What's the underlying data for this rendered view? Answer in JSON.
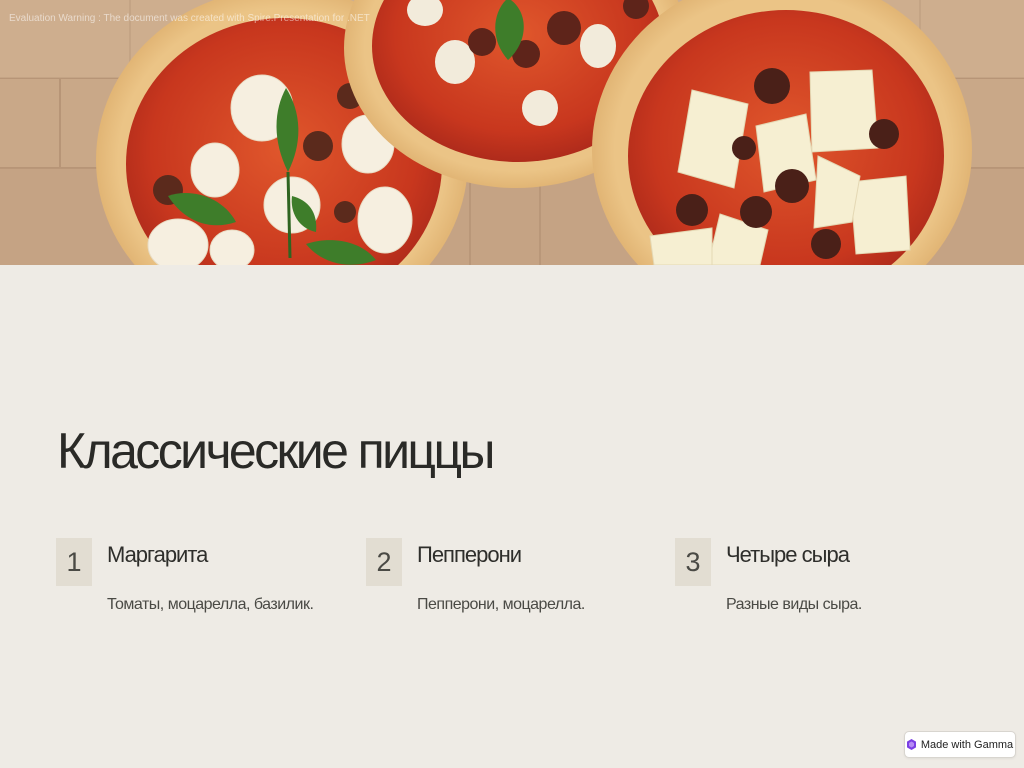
{
  "watermark": "Evaluation Warning : The document was created with  Spire.Presentation for .NET",
  "title": "Классические пиццы",
  "items": [
    {
      "number": "1",
      "name": "Маргарита",
      "description": "Томаты, моцарелла, базилик."
    },
    {
      "number": "2",
      "name": "Пепперони",
      "description": "Пепперони, моцарелла."
    },
    {
      "number": "3",
      "name": "Четыре сыра",
      "description": "Разные виды сыра."
    }
  ],
  "badge": {
    "label": "Made with Gamma",
    "icon": "gamma-logo-icon"
  },
  "hero": {
    "image": "pizzas-on-wooden-table",
    "icons": [
      "pizza-margherita",
      "pizza-pepperoni",
      "pizza-four-cheese"
    ]
  },
  "colors": {
    "background": "#EEEBE5",
    "number_box": "#E2DDD2",
    "title": "#2A2A27",
    "text": "#4A4A45",
    "wood": "#C9A888",
    "crust": "#E5B979",
    "sauce": "#C8371E"
  }
}
